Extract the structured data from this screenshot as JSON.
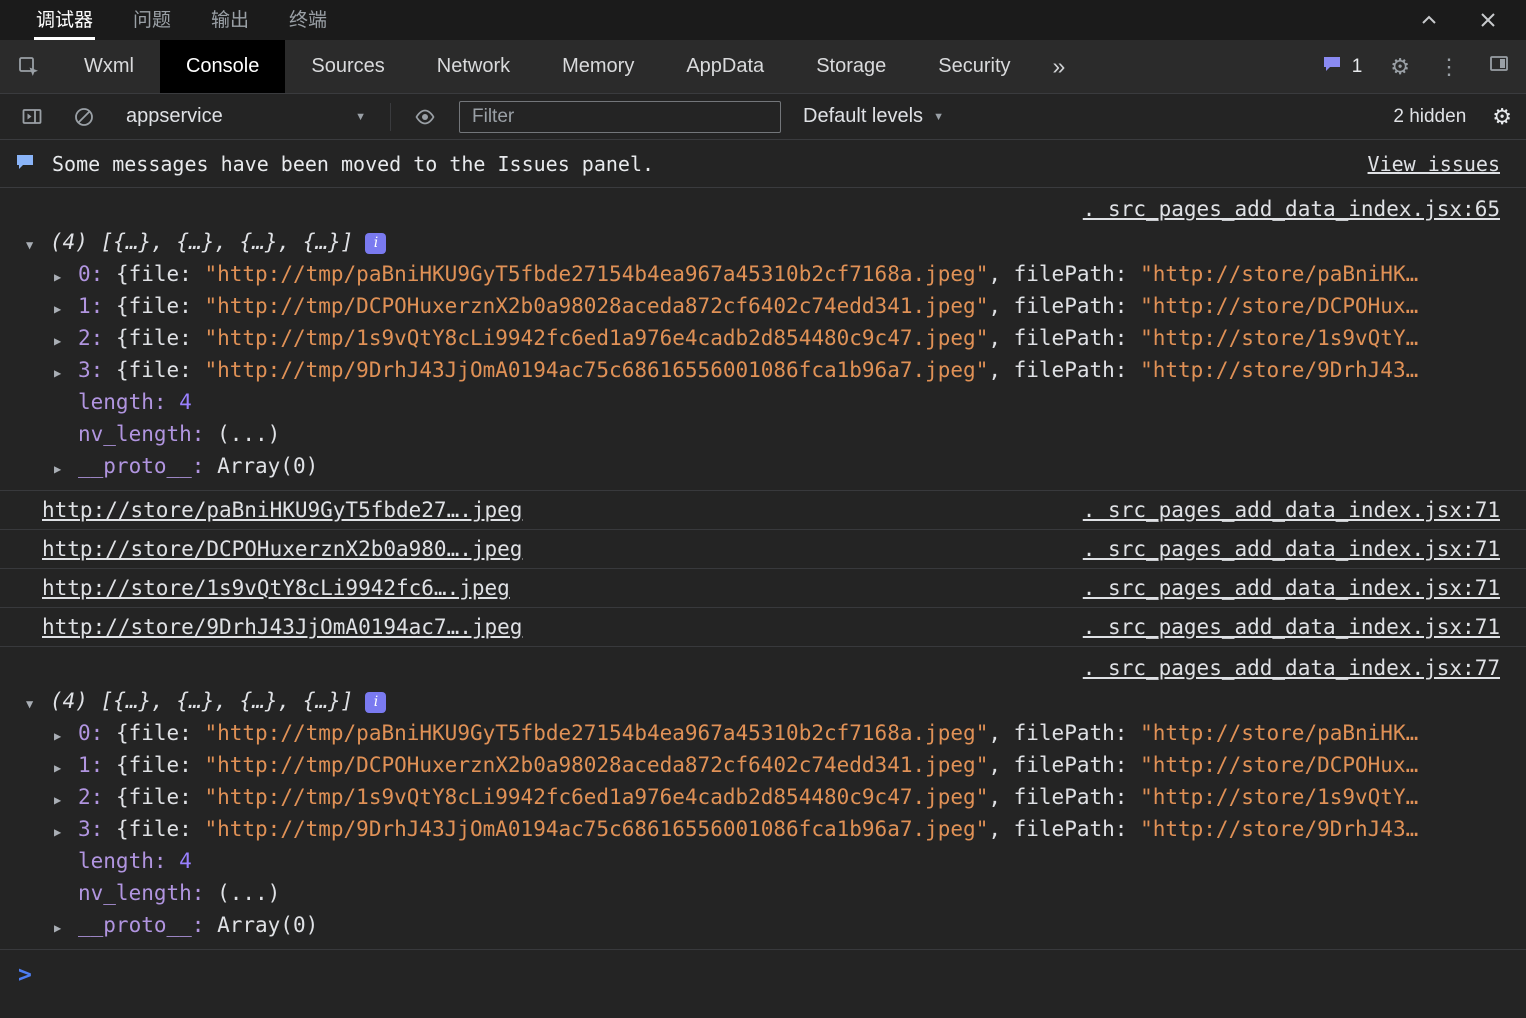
{
  "colors": {
    "background": "#242424",
    "active_tab_bg": "#000000",
    "string": "#e09156",
    "number": "#9980ff",
    "property_key": "#b195e0",
    "link": "#dfe1e5",
    "prompt": "#4d7df2",
    "badge_bg": "#7a7af0",
    "info_icon": "#8ab4f8"
  },
  "glyphs": {
    "caret_down": "▼",
    "expanded": "▼",
    "collapsed": "▶",
    "more_tabs": "»",
    "kebab": "⋮",
    "gear": "⚙",
    "prompt": ">"
  },
  "window": {
    "tabs": [
      {
        "label": "调试器",
        "active": true
      },
      {
        "label": "问题",
        "active": false
      },
      {
        "label": "输出",
        "active": false
      },
      {
        "label": "终端",
        "active": false
      }
    ]
  },
  "devtools": {
    "tabs": [
      {
        "label": "Wxml",
        "active": false
      },
      {
        "label": "Console",
        "active": true
      },
      {
        "label": "Sources",
        "active": false
      },
      {
        "label": "Network",
        "active": false
      },
      {
        "label": "Memory",
        "active": false
      },
      {
        "label": "AppData",
        "active": false
      },
      {
        "label": "Storage",
        "active": false
      },
      {
        "label": "Security",
        "active": false
      }
    ],
    "message_badge": "1"
  },
  "toolbar": {
    "context": "appservice",
    "filter_placeholder": "Filter",
    "levels": "Default levels",
    "hidden_count": "2 hidden"
  },
  "infobar": {
    "message": "Some messages have been moved to the Issues panel.",
    "action": "View issues"
  },
  "console": {
    "sources": {
      "first": ". src_pages_add_data_index.jsx:65",
      "second": ". src_pages_add_data_index.jsx:77"
    },
    "array_log": {
      "preview": "(4) [{…}, {…}, {…}, {…}]",
      "badge": "i",
      "items": [
        {
          "key": "0:",
          "open": "{file:",
          "file": "\"http://tmp/paBniHKU9GyT5fbde27154b4ea967a45310b2cf7168a.jpeg\"",
          "mid": ", filePath:",
          "file_path": "\"http://store/paBniHK…"
        },
        {
          "key": "1:",
          "open": "{file:",
          "file": "\"http://tmp/DCPOHuxerznX2b0a98028aceda872cf6402c74edd341.jpeg\"",
          "mid": ", filePath:",
          "file_path": "\"http://store/DCPOHux…"
        },
        {
          "key": "2:",
          "open": "{file:",
          "file": "\"http://tmp/1s9vQtY8cLi9942fc6ed1a976e4cadb2d854480c9c47.jpeg\"",
          "mid": ", filePath:",
          "file_path": "\"http://store/1s9vQtY…"
        },
        {
          "key": "3:",
          "open": "{file:",
          "file": "\"http://tmp/9DrhJ43JjOmA0194ac75c68616556001086fca1b96a7.jpeg\"",
          "mid": ", filePath:",
          "file_path": "\"http://store/9DrhJ43…"
        }
      ],
      "props": [
        {
          "key": "length:",
          "value": "4"
        },
        {
          "key": "nv_length:",
          "value": "(...)"
        },
        {
          "key": "__proto__:",
          "value": "Array(0)"
        }
      ]
    },
    "link_rows": [
      {
        "text": "http://store/paBniHKU9GyT5fbde27….jpeg",
        "source": ". src_pages_add_data_index.jsx:71"
      },
      {
        "text": "http://store/DCPOHuxerznX2b0a980….jpeg",
        "source": ". src_pages_add_data_index.jsx:71"
      },
      {
        "text": "http://store/1s9vQtY8cLi9942fc6….jpeg",
        "source": ". src_pages_add_data_index.jsx:71"
      },
      {
        "text": "http://store/9DrhJ43JjOmA0194ac7….jpeg",
        "source": ". src_pages_add_data_index.jsx:71"
      }
    ]
  }
}
